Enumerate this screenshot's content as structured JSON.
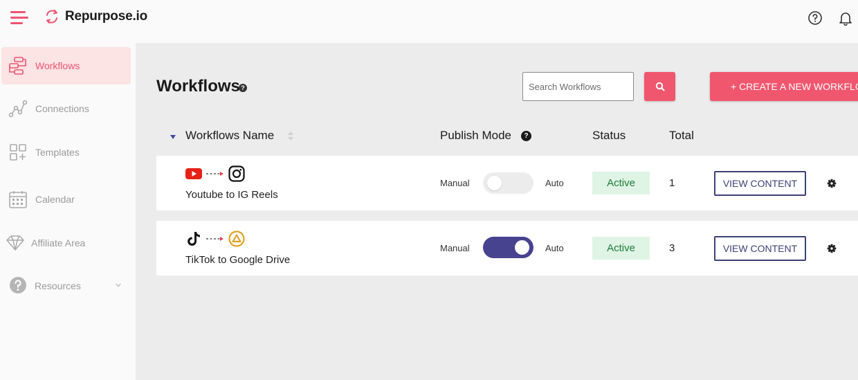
{
  "app": {
    "name": "Repurpose.io"
  },
  "colors": {
    "accent": "#f0566e",
    "toggle_on": "#47438f",
    "active_badge_bg": "#dff4e4",
    "active_badge_text": "#1e7a3c"
  },
  "topbar": {
    "menu_icon": "hamburger-icon",
    "help_icon": "question-circle-icon",
    "notifications_icon": "bell-icon"
  },
  "sidebar": {
    "items": [
      {
        "label": "Workflows",
        "icon": "workflow-icon",
        "active": true
      },
      {
        "label": "Connections",
        "icon": "connections-icon",
        "active": false
      },
      {
        "label": "Templates",
        "icon": "templates-icon",
        "active": false
      },
      {
        "label": "Calendar",
        "icon": "calendar-icon",
        "active": false
      },
      {
        "label": "Affiliate Area",
        "icon": "diamond-icon",
        "active": false
      },
      {
        "label": "Resources",
        "icon": "help-circle-icon",
        "active": false,
        "has_submenu": true
      }
    ]
  },
  "main": {
    "title": "Workflows",
    "search": {
      "placeholder": "Search Workflows",
      "value": ""
    },
    "create_button": "+ CREATE A NEW WORKFLOW",
    "columns": {
      "name": "Workflows Name",
      "publish_mode": "Publish Mode",
      "status": "Status",
      "total": "Total"
    },
    "rows": [
      {
        "source_icon": "youtube-icon",
        "dest_icon": "instagram-icon",
        "name": "Youtube to IG Reels",
        "manual_label": "Manual",
        "auto_label": "Auto",
        "auto_enabled": false,
        "status": "Active",
        "total": "1",
        "action": "VIEW CONTENT"
      },
      {
        "source_icon": "tiktok-icon",
        "dest_icon": "google-drive-icon",
        "name": "TikTok to Google Drive",
        "manual_label": "Manual",
        "auto_label": "Auto",
        "auto_enabled": true,
        "status": "Active",
        "total": "3",
        "action": "VIEW CONTENT"
      }
    ]
  }
}
